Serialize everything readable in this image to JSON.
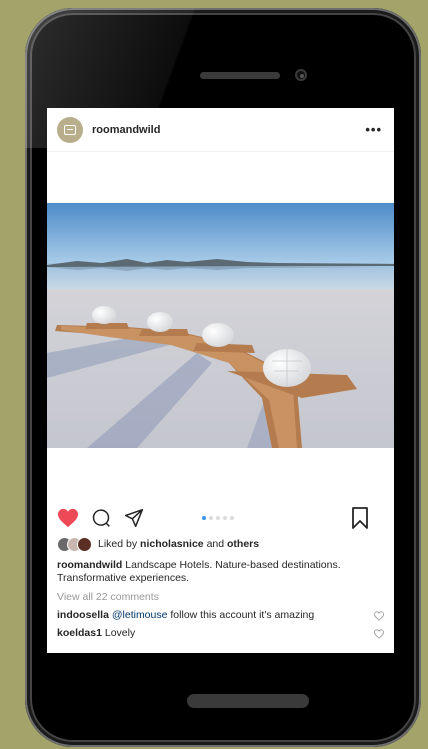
{
  "post": {
    "username": "roomandwild",
    "more_label": "•••",
    "carousel": {
      "count": 5,
      "active_index": 0
    },
    "liked": true,
    "likes": {
      "prefix": "Liked by",
      "user": "nicholasnice",
      "joiner": "and",
      "others": "others"
    },
    "caption": {
      "username": "roomandwild",
      "text": "Landscape Hotels. Nature-based destinations. Transformative experiences."
    },
    "view_all_comments": "View all 22 comments",
    "comments": [
      {
        "username": "indoosella",
        "mention": "@letimouse",
        "text": "follow this account it's amazing"
      },
      {
        "username": "koeldas1",
        "mention": "",
        "text": "Lovely"
      }
    ]
  },
  "colors": {
    "liked_heart": "#ed4956",
    "link_blue": "#3897f0",
    "background": "#a3a46a"
  },
  "icons": [
    "heart-icon",
    "comment-icon",
    "share-icon",
    "bookmark-icon",
    "more-icon"
  ]
}
